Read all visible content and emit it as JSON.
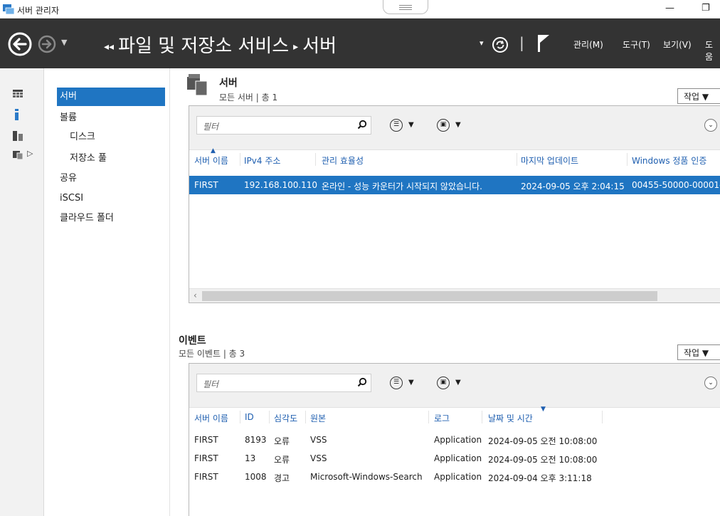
{
  "window": {
    "title": "서버 관리자",
    "minimize": "—",
    "restore": "❐"
  },
  "nav": {
    "breadcrumb_arrows": "◂◂",
    "crumb_1": "파일 및 저장소 서비스",
    "separator": "▸",
    "crumb_2": "서버",
    "refresh_arrow": "▾",
    "divider": "|",
    "menu": [
      "관리(M)",
      "도구(T)",
      "보기(V)",
      "도움"
    ]
  },
  "sidebar": {
    "items": [
      {
        "label": "서버",
        "selected": true
      },
      {
        "label": "볼륨"
      },
      {
        "label": "디스크"
      },
      {
        "label": "저장소 풀"
      },
      {
        "label": "공유"
      },
      {
        "label": "iSCSI"
      },
      {
        "label": "클라우드 폴더"
      }
    ]
  },
  "servers": {
    "title": "서버",
    "subtitle": "모든 서버 | 총 1",
    "tasks": "작업 ▼",
    "filter_placeholder": "필터",
    "columns": [
      "서버 이름",
      "IPv4 주소",
      "관리 효율성",
      "마지막 업데이트",
      "Windows 정품 인증"
    ],
    "rows": [
      [
        "FIRST",
        "192.168.100.110",
        "온라인 - 성능 카운터가 시작되지 않았습니다.",
        "2024-09-05 오후 2:04:15",
        "00455-50000-00001-"
      ]
    ],
    "scroll_left": "‹"
  },
  "events": {
    "title": "이벤트",
    "subtitle": "모든 이벤트 | 총 3",
    "tasks": "작업 ▼",
    "filter_placeholder": "필터",
    "columns": [
      "서버 이름",
      "ID",
      "심각도",
      "원본",
      "로그",
      "날짜 및 시간"
    ],
    "rows": [
      [
        "FIRST",
        "8193",
        "오류",
        "VSS",
        "Application",
        "2024-09-05 오전 10:08:00"
      ],
      [
        "FIRST",
        "13",
        "오류",
        "VSS",
        "Application",
        "2024-09-05 오전 10:08:00"
      ],
      [
        "FIRST",
        "1008",
        "경고",
        "Microsoft-Windows-Search",
        "Application",
        "2024-09-04 오후 3:11:18"
      ]
    ]
  },
  "glyphs": {
    "caret": "▼",
    "list_btn": "☰",
    "save_btn": "▣",
    "expand": "⌄",
    "strip_expand": "▷"
  },
  "colors": {
    "navbar": "#333333",
    "selection": "#1f75c2",
    "header_link": "#1f5fb0"
  }
}
